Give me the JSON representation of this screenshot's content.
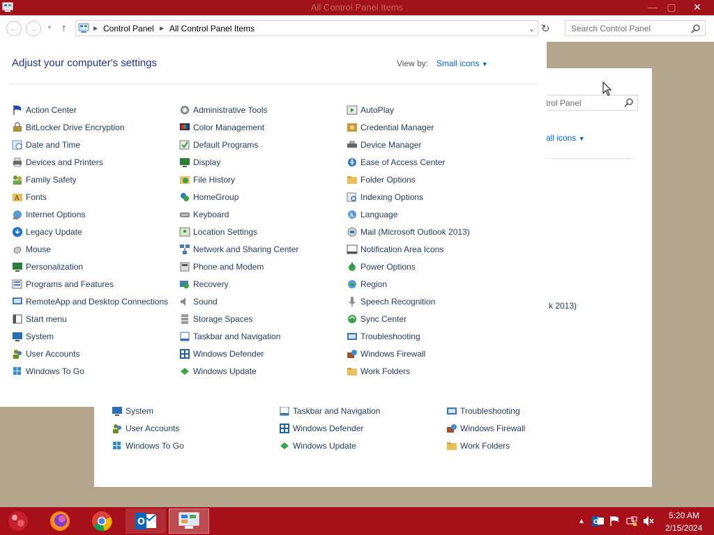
{
  "window": {
    "title": "All Control Panel Items"
  },
  "address": {
    "crumbs": [
      "Control Panel",
      "All Control Panel Items"
    ]
  },
  "search": {
    "placeholder": "Search Control Panel"
  },
  "panel": {
    "heading": "Adjust your computer's settings",
    "view_by_label": "View by:",
    "view_by_value": "Small icons"
  },
  "columns": [
    [
      "Action Center",
      "BitLocker Drive Encryption",
      "Date and Time",
      "Devices and Printers",
      "Family Safety",
      "Fonts",
      "Internet Options",
      "Legacy Update",
      "Mouse",
      "Personalization",
      "Programs and Features",
      "RemoteApp and Desktop Connections",
      "Start menu",
      "System",
      "User Accounts",
      "Windows To Go"
    ],
    [
      "Administrative Tools",
      "Color Management",
      "Default Programs",
      "Display",
      "File History",
      "HomeGroup",
      "Keyboard",
      "Location Settings",
      "Network and Sharing Center",
      "Phone and Modem",
      "Recovery",
      "Sound",
      "Storage Spaces",
      "Taskbar and Navigation",
      "Windows Defender",
      "Windows Update"
    ],
    [
      "AutoPlay",
      "Credential Manager",
      "Device Manager",
      "Ease of Access Center",
      "Folder Options",
      "Indexing Options",
      "Language",
      "Mail (Microsoft Outlook 2013)",
      "Notification Area Icons",
      "Power Options",
      "Region",
      "Speech Recognition",
      "Sync Center",
      "Troubleshooting",
      "Windows Firewall",
      "Work Folders"
    ]
  ],
  "back_window": {
    "search_fragment": "trol Panel",
    "view_fragment": "all icons",
    "mail_fragment": "k 2013)",
    "rows": [
      [
        "System",
        "Taskbar and Navigation",
        "Troubleshooting"
      ],
      [
        "User Accounts",
        "Windows Defender",
        "Windows Firewall"
      ],
      [
        "Windows To Go",
        "Windows Update",
        "Work Folders"
      ]
    ]
  },
  "taskbar": {
    "apps": [
      "start-orb",
      "firefox",
      "chrome",
      "outlook",
      "control-panel"
    ]
  },
  "clock": {
    "time": "5:20 AM",
    "date": "2/15/2024"
  },
  "colors": {
    "titlebar": "#a2121a",
    "taskbar": "#a70f19",
    "link": "#1e395b",
    "accent": "#0066cc"
  }
}
